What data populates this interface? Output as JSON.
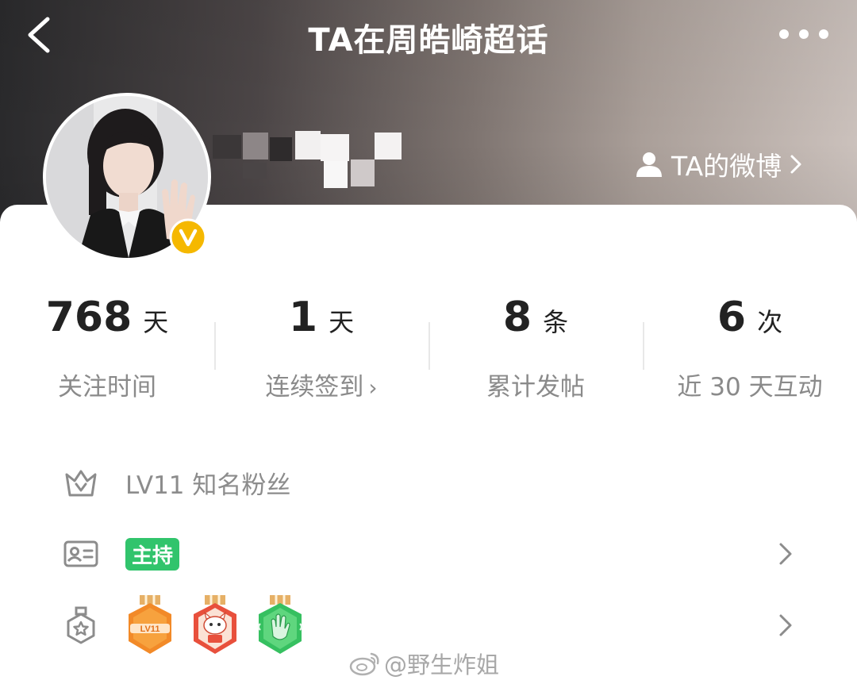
{
  "header": {
    "title": "TA在周皓崎超话",
    "weibo_link_label": "TA的微博"
  },
  "stats": [
    {
      "value": "768",
      "unit": "天",
      "label": "关注时间",
      "has_arrow": false
    },
    {
      "value": "1",
      "unit": "天",
      "label": "连续签到",
      "has_arrow": true
    },
    {
      "value": "8",
      "unit": "条",
      "label": "累计发帖",
      "has_arrow": false
    },
    {
      "value": "6",
      "unit": "次",
      "label": "近 30 天互动",
      "has_arrow": false
    }
  ],
  "level": {
    "text": "LV11 知名粉丝"
  },
  "role": {
    "badge": "主持"
  },
  "medals": {
    "items": [
      {
        "icon": "lv11-medal-icon",
        "text": "LV11"
      },
      {
        "icon": "mascot-medal-icon"
      },
      {
        "icon": "hand-medal-icon"
      }
    ]
  },
  "watermark": {
    "text": "@野生炸姐"
  },
  "colors": {
    "accent_green": "#31c46c",
    "verified_gold": "#f5b800",
    "text_dark": "#222222",
    "text_gray": "#8a8a8a"
  }
}
